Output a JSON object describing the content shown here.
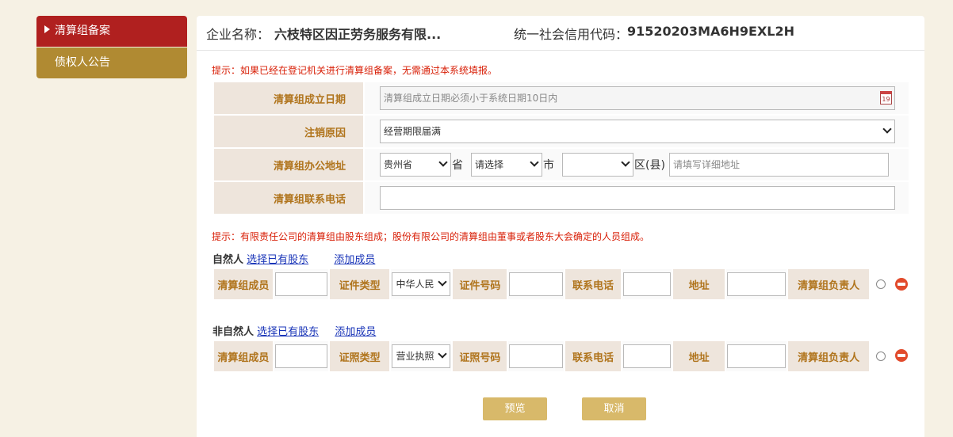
{
  "sidebar": {
    "items": [
      {
        "label": "清算组备案"
      },
      {
        "label": "债权人公告"
      }
    ]
  },
  "header": {
    "company_label": "企业名称：",
    "company_name": "六枝特区因正劳务服务有限...",
    "credit_label": "统一社会信用代码：",
    "credit_code": "91520203MA6H9EXL2H"
  },
  "tips": {
    "top": "提示：如果已经在登记机关进行清算组备案，无需通过本系统填报。",
    "members": "提示：有限责任公司的清算组由股东组成；股份有限公司的清算组由董事或者股东大会确定的人员组成。"
  },
  "form": {
    "date_label": "清算组成立日期",
    "date_placeholder": "清算组成立日期必须小于系统日期10日内",
    "calendar_day": "19",
    "reason_label": "注销原因",
    "reason_value": "经营期限届满",
    "address_label": "清算组办公地址",
    "province_value": "贵州省",
    "province_unit": "省",
    "city_value": "请选择",
    "city_unit": "市",
    "district_value": "",
    "district_unit": "区(县)",
    "address_placeholder": "请填写详细地址",
    "phone_label": "清算组联系电话"
  },
  "natural": {
    "title": "自然人",
    "select_link": "选择已有股东",
    "add_link": "添加成员",
    "cols": {
      "member": "清算组成员",
      "id_type": "证件类型",
      "id_type_value": "中华人民",
      "id_no": "证件号码",
      "phone": "联系电话",
      "address": "地址",
      "leader": "清算组负责人"
    }
  },
  "legal": {
    "title": "非自然人",
    "select_link": "选择已有股东",
    "add_link": "添加成员",
    "cols": {
      "member": "清算组成员",
      "id_type": "证照类型",
      "id_type_value": "营业执照",
      "id_no": "证照号码",
      "phone": "联系电话",
      "address": "地址",
      "leader": "清算组负责人"
    }
  },
  "buttons": {
    "preview": "预览",
    "cancel": "取消"
  }
}
